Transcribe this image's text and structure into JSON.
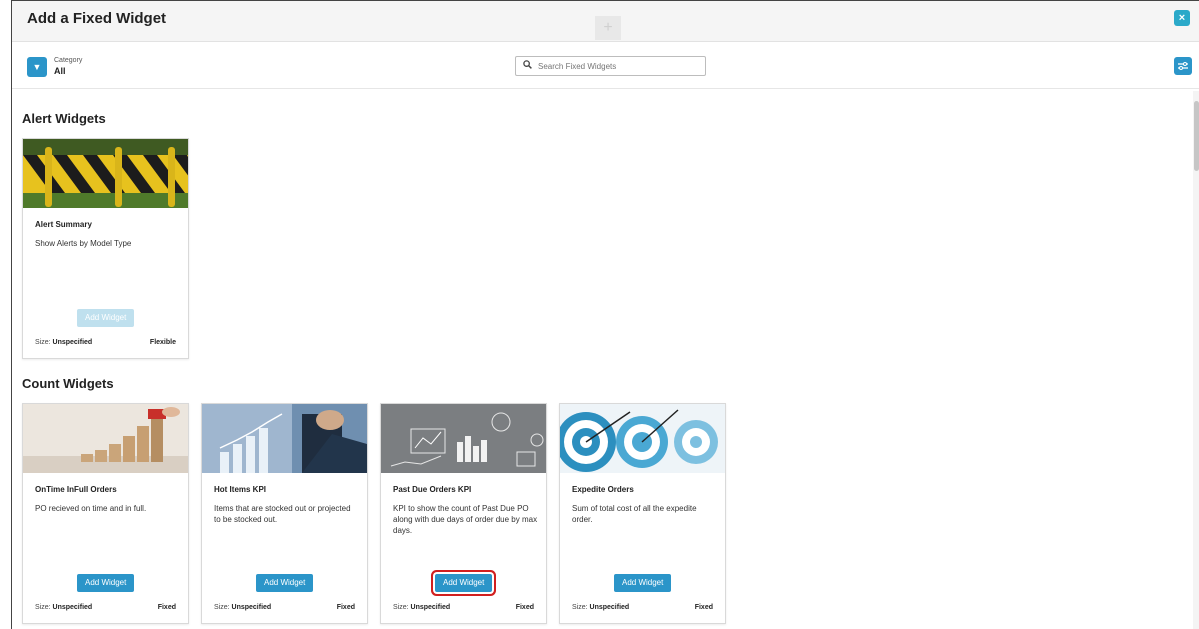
{
  "dialog": {
    "title": "Add a Fixed Widget",
    "close_icon": "×",
    "ghost_add": "+"
  },
  "toolbar": {
    "category_label": "Category",
    "category_value": "All",
    "search_placeholder": "Search Fixed Widgets"
  },
  "colors": {
    "accent": "#2b95c9",
    "highlight": "#d11f1f"
  },
  "sections": [
    {
      "title": "Alert Widgets",
      "cards": [
        {
          "name": "Alert Summary",
          "description": "Show Alerts by Model Type",
          "button": "Add Widget",
          "button_state": "disabled",
          "size_label": "Size:",
          "size_value": "Unspecified",
          "type": "Flexible",
          "image": "road-barrier-image"
        }
      ]
    },
    {
      "title": "Count Widgets",
      "cards": [
        {
          "name": "OnTime InFull Orders",
          "description": "PO recieved on time and in full.",
          "button": "Add Widget",
          "button_state": "enabled",
          "size_label": "Size:",
          "size_value": "Unspecified",
          "type": "Fixed",
          "image": "growth-blocks-image"
        },
        {
          "name": "Hot Items KPI",
          "description": "Items that are stocked out or projected to be stocked out.",
          "button": "Add Widget",
          "button_state": "enabled",
          "size_label": "Size:",
          "size_value": "Unspecified",
          "type": "Fixed",
          "image": "business-chart-image"
        },
        {
          "name": "Past Due Orders KPI",
          "description": "KPI to show the count of Past Due PO along with due days of order due by max days.",
          "button": "Add Widget",
          "button_state": "highlighted",
          "size_label": "Size:",
          "size_value": "Unspecified",
          "type": "Fixed",
          "image": "analytics-icons-image"
        },
        {
          "name": "Expedite Orders",
          "description": "Sum of total cost of all the expedite order.",
          "button": "Add Widget",
          "button_state": "enabled",
          "size_label": "Size:",
          "size_value": "Unspecified",
          "type": "Fixed",
          "image": "target-arrows-image"
        }
      ]
    }
  ]
}
